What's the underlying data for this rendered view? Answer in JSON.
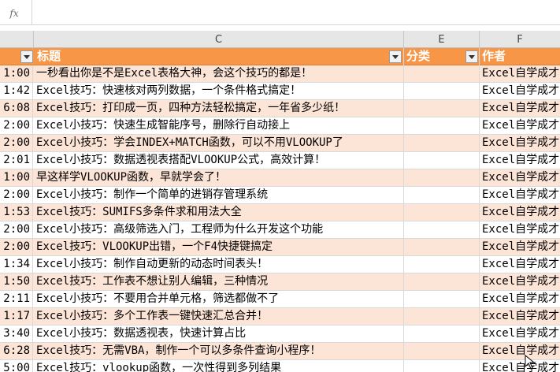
{
  "formula_bar": {
    "fx_label": "fx",
    "value": ""
  },
  "columns": {
    "c": "C",
    "e": "E",
    "f": "F"
  },
  "table_header": {
    "time": "",
    "title": "标题",
    "category": "分类",
    "author": "作者"
  },
  "rows": [
    {
      "time": "1:00",
      "title": "一秒看出你是不是Excel表格大神，会这个技巧的都是！",
      "category": "",
      "author": "Excel自学成才"
    },
    {
      "time": "1:42",
      "title": "Excel技巧：快速核对两列数据，一个条件格式搞定！",
      "category": "",
      "author": "Excel自学成才"
    },
    {
      "time": "6:08",
      "title": "Excel技巧：打印成一页，四种方法轻松搞定，一年省多少纸！",
      "category": "",
      "author": "Excel自学成才"
    },
    {
      "time": "2:00",
      "title": "Excel小技巧：快速生成智能序号，删除行自动接上",
      "category": "",
      "author": "Excel自学成才"
    },
    {
      "time": "2:00",
      "title": "Excel小技巧：学会INDEX+MATCH函数，可以不用VLOOKUP了",
      "category": "",
      "author": "Excel自学成才"
    },
    {
      "time": "2:01",
      "title": "Excel小技巧：数据透视表搭配VLOOKUP公式，高效计算！",
      "category": "",
      "author": "Excel自学成才"
    },
    {
      "time": "1:00",
      "title": "早这样学VLOOKUP函数，早就学会了！",
      "category": "",
      "author": "Excel自学成才"
    },
    {
      "time": "2:00",
      "title": "Excel小技巧：制作一个简单的进销存管理系统",
      "category": "",
      "author": "Excel自学成才"
    },
    {
      "time": "1:53",
      "title": "Excel技巧：SUMIFS多条件求和用法大全",
      "category": "",
      "author": "Excel自学成才"
    },
    {
      "time": "2:00",
      "title": "Excel小技巧：高级筛选入门，工程师为什么开发这个功能",
      "category": "",
      "author": "Excel自学成才"
    },
    {
      "time": "2:00",
      "title": "Excel技巧：VLOOKUP出错，一个F4快捷键搞定",
      "category": "",
      "author": "Excel自学成才"
    },
    {
      "time": "1:34",
      "title": "Excel小技巧：制作自动更新的动态时间表头！",
      "category": "",
      "author": "Excel自学成才"
    },
    {
      "time": "1:50",
      "title": "Excel技巧：工作表不想让别人编辑，三种情况",
      "category": "",
      "author": "Excel自学成才"
    },
    {
      "time": "2:11",
      "title": "Excel小技巧：不要用合并单元格，筛选都做不了",
      "category": "",
      "author": "Excel自学成才"
    },
    {
      "time": "1:17",
      "title": "Excel小技巧：多个工作表一键快速汇总合并！",
      "category": "",
      "author": "Excel自学成才"
    },
    {
      "time": "3:40",
      "title": "Excel小技巧：数据透视表，快速计算占比",
      "category": "",
      "author": "Excel自学成才"
    },
    {
      "time": "6:28",
      "title": "Excel技巧：无需VBA，制作一个可以多条件查询小程序！",
      "category": "",
      "author": "Excel自学成才"
    },
    {
      "time": "5:00",
      "title": "Excel技巧：vlookup函数，一次性得到多列结果",
      "category": "",
      "author": "Excel自学成才"
    }
  ],
  "colors": {
    "header_fill": "#f79646",
    "band_fill": "#fce4d6",
    "column_header_bg": "#e6e6e6"
  }
}
